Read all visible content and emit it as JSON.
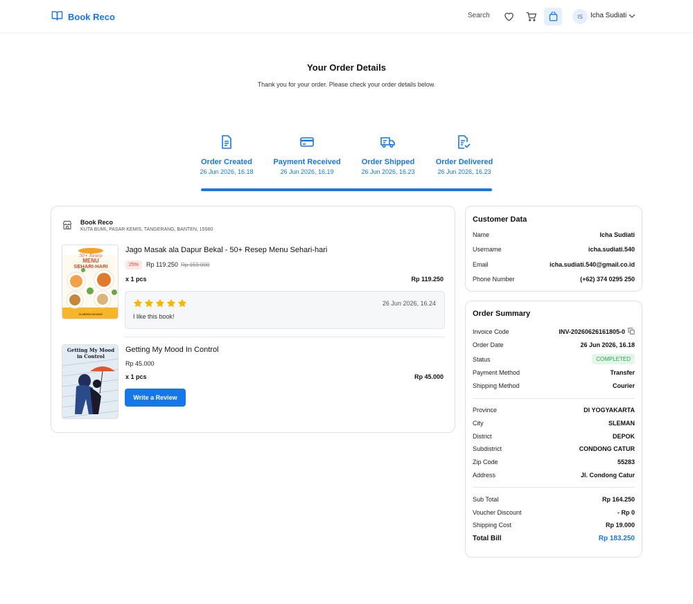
{
  "header": {
    "brand": "Book Reco",
    "search_label": "Search",
    "user": {
      "initials": "IS",
      "name": "Icha Sudiati"
    }
  },
  "page": {
    "title": "Your Order Details",
    "subtitle": "Thank you for your order. Please check your order details below."
  },
  "steps": [
    {
      "label": "Order Created",
      "time": "26 Jun 2026, 16.18",
      "icon": "document-icon"
    },
    {
      "label": "Payment Received",
      "time": "26 Jun 2026, 16.19",
      "icon": "credit-card-icon"
    },
    {
      "label": "Order Shipped",
      "time": "26 Jun 2026, 16.23",
      "icon": "truck-icon"
    },
    {
      "label": "Order Delivered",
      "time": "26 Jun 2026, 16.23",
      "icon": "document-check-icon"
    }
  ],
  "progress_fraction": 1.0,
  "accent_color": "#1677e8",
  "store": {
    "name": "Book Reco",
    "address": "KUTA BUMI, PASAR KEMIS, TANGERANG, BANTEN, 15560"
  },
  "items": [
    {
      "title": "Jago Masak ala Dapur Bekal - 50+ Resep Menu Sehari-hari",
      "discount": "25%",
      "price": "Rp 119.250",
      "old_price": "Rp 159.000",
      "qty": "x 1 pcs",
      "total": "Rp 119.250",
      "cover": {
        "top": "50+ Resep",
        "title1": "MENU",
        "title2": "SEHARI-HARI",
        "author": "CLARISSA NOVIANY"
      },
      "review": {
        "rating": 5,
        "date": "26 Jun 2026, 16.24",
        "text": "I like this book!"
      }
    },
    {
      "title": "Getting My Mood In Control",
      "price": "Rp 45.000",
      "qty": "x 1 pcs",
      "total": "Rp 45.000",
      "cover": {
        "title1": "Getting My Mood",
        "title2": "in Control"
      },
      "button": "Write a Review"
    }
  ],
  "customer": {
    "title": "Customer Data",
    "rows": [
      {
        "k": "Name",
        "v": "Icha Sudiati"
      },
      {
        "k": "Username",
        "v": "icha.sudiati.540"
      },
      {
        "k": "Email",
        "v": "icha.sudiati.540@gmail.co.id"
      },
      {
        "k": "Phone Number",
        "v": "(+62) 374 0295 250"
      }
    ]
  },
  "summary": {
    "title": "Order Summary",
    "order": [
      {
        "k": "Invoice Code",
        "v": "INV-20260626161805-0"
      },
      {
        "k": "Order Date",
        "v": "26 Jun 2026, 16.18"
      },
      {
        "k": "Status",
        "v": "COMPLETED"
      },
      {
        "k": "Payment Method",
        "v": "Transfer"
      },
      {
        "k": "Shipping Method",
        "v": "Courier"
      }
    ],
    "address": [
      {
        "k": "Province",
        "v": "DI YOGYAKARTA"
      },
      {
        "k": "City",
        "v": "SLEMAN"
      },
      {
        "k": "District",
        "v": "DEPOK"
      },
      {
        "k": "Subdistrict",
        "v": "CONDONG CATUR"
      },
      {
        "k": "Zip Code",
        "v": "55283"
      },
      {
        "k": "Address",
        "v": "Jl. Condong Catur"
      }
    ],
    "costs": [
      {
        "k": "Sub Total",
        "v": "Rp 164.250"
      },
      {
        "k": "Voucher Discount",
        "v": "- Rp 0"
      },
      {
        "k": "Shipping Cost",
        "v": "Rp 19.000"
      }
    ],
    "total": {
      "k": "Total Bill",
      "v": "Rp 183.250"
    }
  }
}
